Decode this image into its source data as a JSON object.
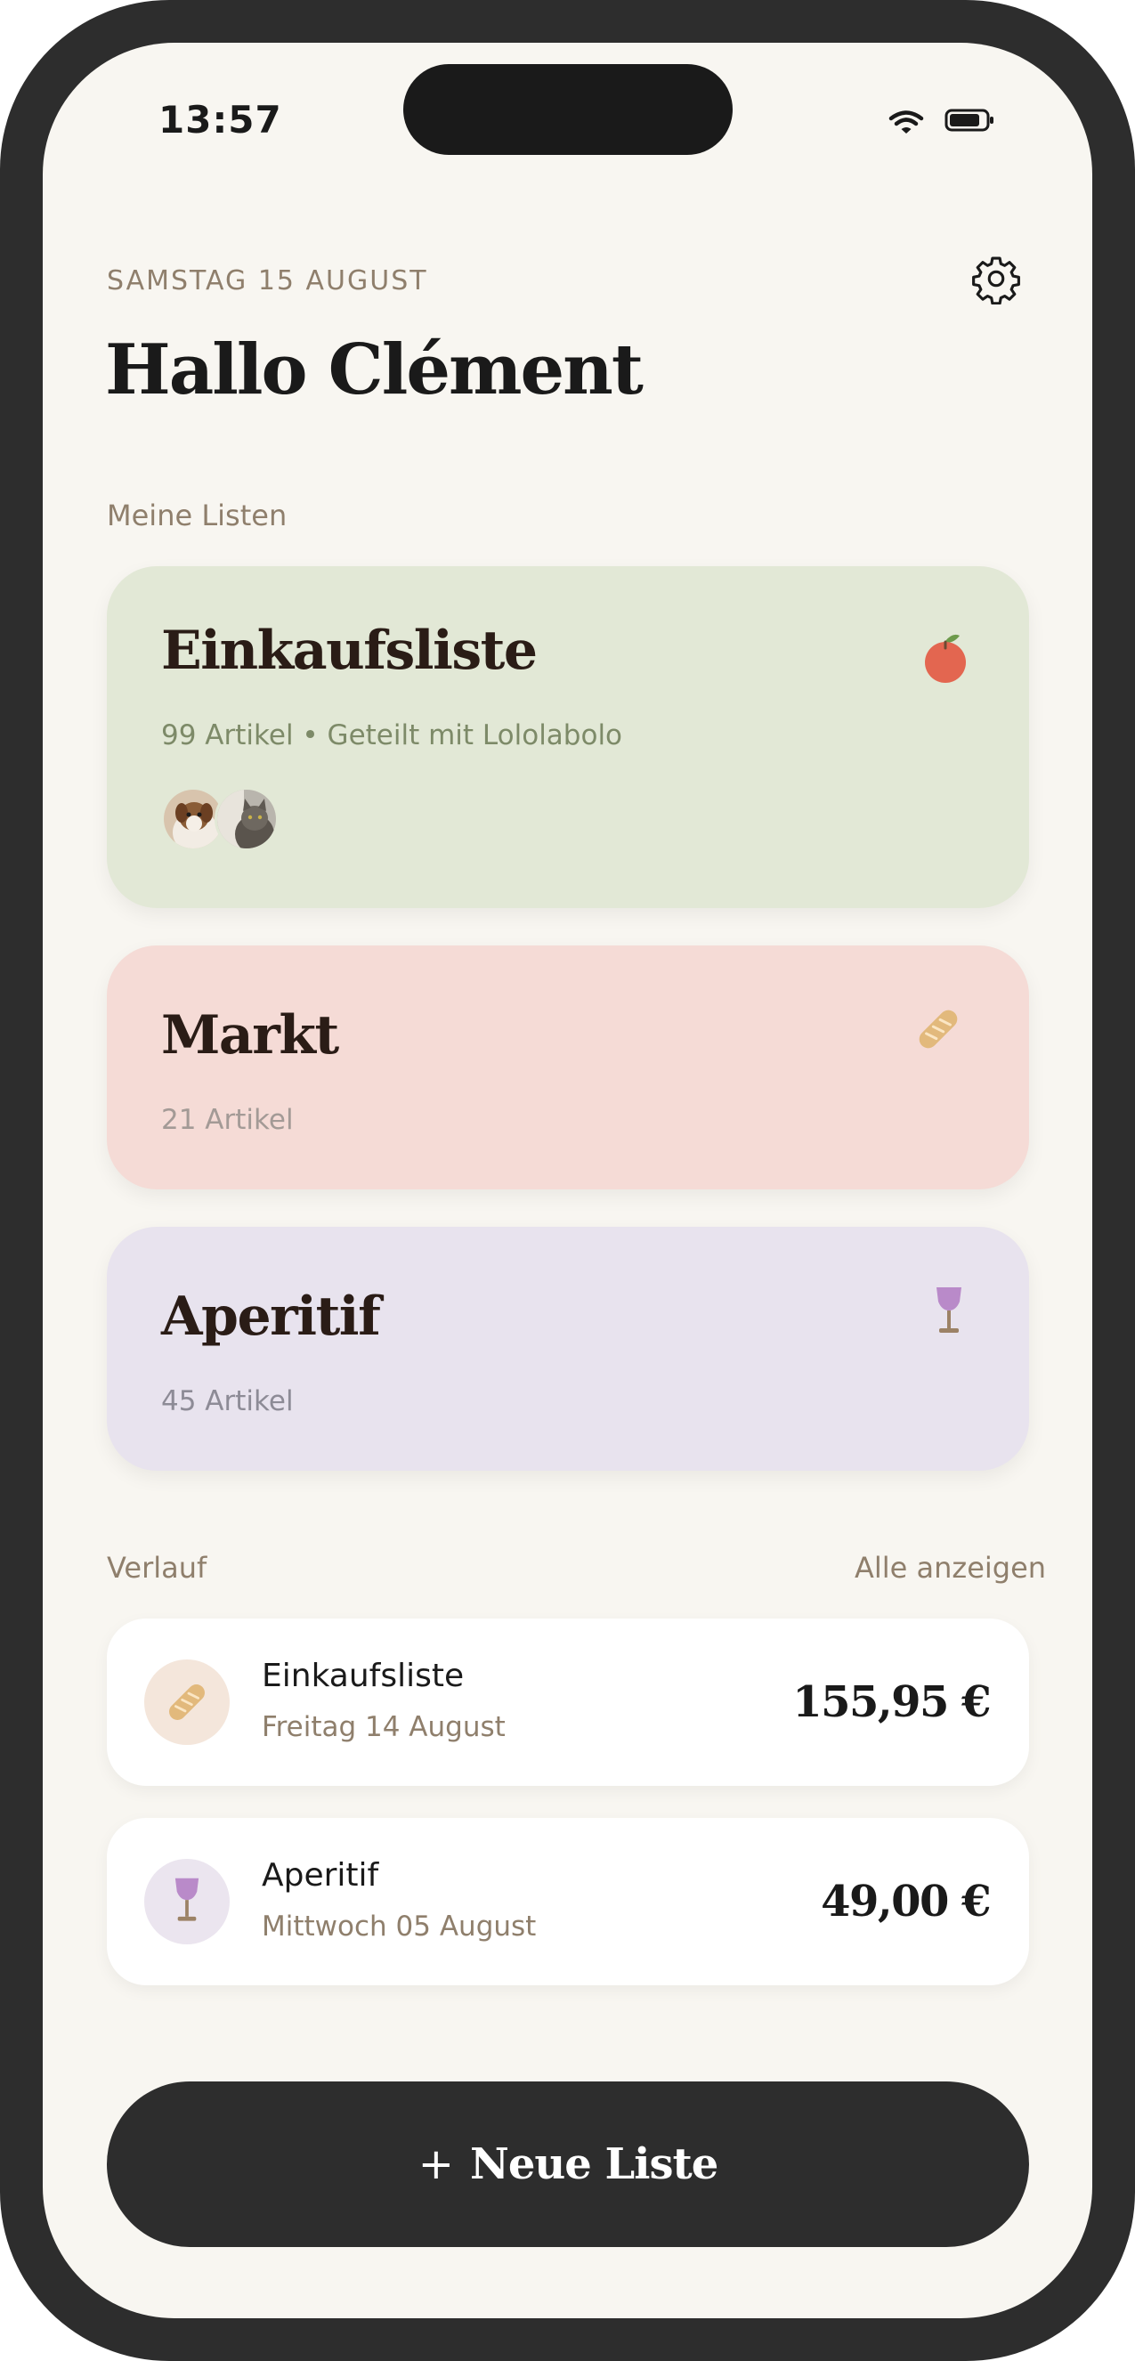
{
  "status_bar": {
    "time": "13:57",
    "icons": [
      "wifi-icon",
      "battery-icon"
    ]
  },
  "header": {
    "date": "SAMSTAG 15 AUGUST",
    "greeting": "Hallo Clément",
    "settings_icon": "gear-icon"
  },
  "lists_section": {
    "label": "Meine Listen",
    "lists": [
      {
        "title": "Einkaufsliste",
        "subtitle": "99 Artikel • Geteilt mit Lololabolo",
        "icon": "apple-icon",
        "bg_color": "#e2e8d6",
        "sub_color": "#7d8a68",
        "avatars": [
          "dog-avatar",
          "cat-avatar"
        ]
      },
      {
        "title": "Markt",
        "subtitle": "21 Artikel",
        "icon": "baguette-icon",
        "bg_color": "#f5dbd6",
        "sub_color": "#a39a96"
      },
      {
        "title": "Aperitif",
        "subtitle": "45 Artikel",
        "icon": "wine-glass-icon",
        "bg_color": "#e8e3ee",
        "sub_color": "#8d8b96"
      }
    ]
  },
  "history_section": {
    "label": "Verlauf",
    "see_all": "Alle anzeigen",
    "items": [
      {
        "title": "Einkaufsliste",
        "date": "Freitag 14 August",
        "amount": "155,95 €",
        "icon": "baguette-icon",
        "circle_color": "#f4e6db"
      },
      {
        "title": "Aperitif",
        "date": "Mittwoch 05 August",
        "amount": "49,00 €",
        "icon": "wine-glass-icon",
        "circle_color": "#ebe5ef"
      }
    ]
  },
  "new_list_button": {
    "plus": "+",
    "label": "Neue Liste"
  }
}
